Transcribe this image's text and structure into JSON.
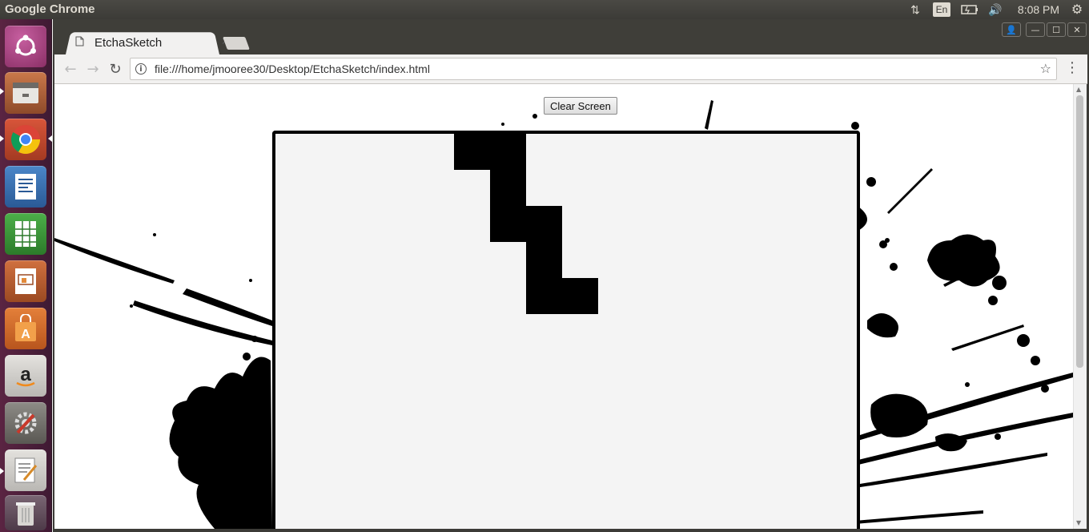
{
  "top_panel": {
    "app_title": "Google Chrome",
    "language": "En",
    "clock": "8:08 PM",
    "icons": [
      "network-icon",
      "keyboard-language-icon",
      "battery-icon",
      "volume-icon",
      "system-gear-icon"
    ]
  },
  "launcher": {
    "items": [
      {
        "name": "ubuntu-dash",
        "icon": "ubuntu-logo-icon",
        "color": "#b54d8e"
      },
      {
        "name": "files",
        "icon": "file-cabinet-icon",
        "color": "#b9673a"
      },
      {
        "name": "chrome",
        "icon": "chrome-icon",
        "color": "#c44e2a"
      },
      {
        "name": "writer",
        "icon": "writer-doc-icon",
        "color": "#3d76b8"
      },
      {
        "name": "calc",
        "icon": "calc-sheet-icon",
        "color": "#3d9d3a"
      },
      {
        "name": "impress",
        "icon": "impress-slide-icon",
        "color": "#c0603a"
      },
      {
        "name": "software-center",
        "icon": "shopping-bag-icon",
        "color": "#d96a2e"
      },
      {
        "name": "amazon",
        "icon": "amazon-icon",
        "color": "#c9c7c3"
      },
      {
        "name": "system-settings",
        "icon": "settings-wrench-icon",
        "color": "#7a7873"
      },
      {
        "name": "text-editor",
        "icon": "text-editor-icon",
        "color": "#c9c7c3"
      },
      {
        "name": "trash",
        "icon": "trash-icon",
        "color": "#6e5a68"
      }
    ]
  },
  "browser": {
    "tab_title": "EtchaSketch",
    "url": "file:///home/jmooree30/Desktop/EtchaSketch/index.html"
  },
  "page": {
    "clear_button_label": "Clear Screen",
    "board_bg": "#f4f4f4",
    "filled_cells": [
      {
        "col": 5,
        "row": 0
      },
      {
        "col": 6,
        "row": 0
      },
      {
        "col": 6,
        "row": 1
      },
      {
        "col": 6,
        "row": 2
      },
      {
        "col": 7,
        "row": 2
      },
      {
        "col": 7,
        "row": 3
      },
      {
        "col": 7,
        "row": 4
      },
      {
        "col": 8,
        "row": 4
      }
    ]
  }
}
